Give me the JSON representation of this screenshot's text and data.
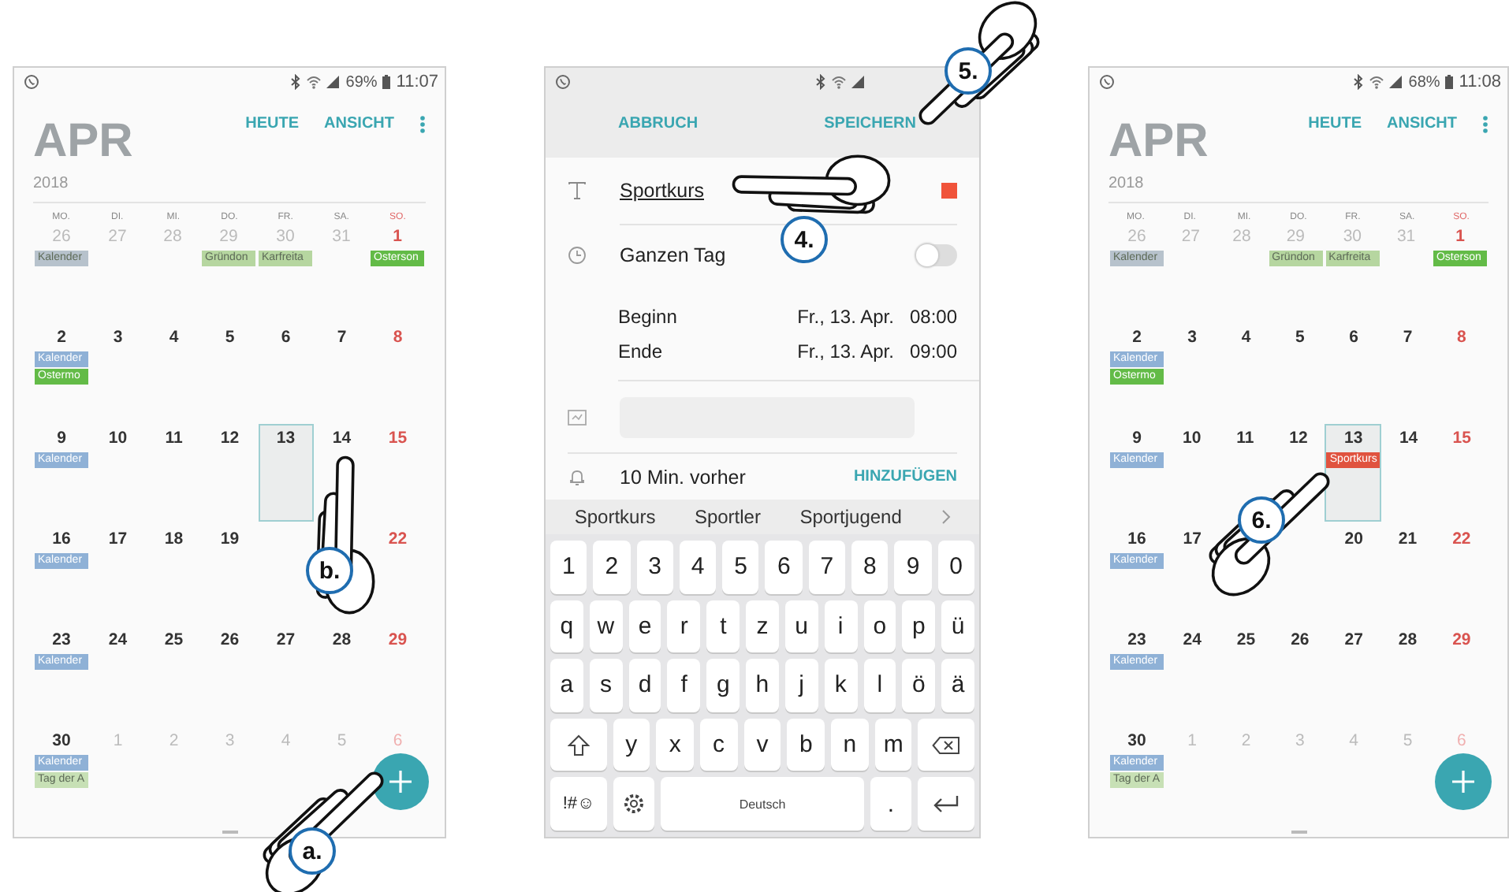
{
  "screens": [
    {
      "kind": "month",
      "status": {
        "battery": "69%",
        "time": "11:07"
      },
      "month": "APR",
      "year": "2018",
      "actions": [
        "HEUTE",
        "ANSICHT"
      ],
      "weekdays": [
        {
          "label": "MO.",
          "sunday": false
        },
        {
          "label": "DI.",
          "sunday": false
        },
        {
          "label": "MI.",
          "sunday": false
        },
        {
          "label": "DO.",
          "sunday": false
        },
        {
          "label": "FR.",
          "sunday": false
        },
        {
          "label": "SA.",
          "sunday": false
        },
        {
          "label": "SO.",
          "sunday": true
        }
      ],
      "weeks": [
        [
          {
            "day": "26",
            "muted": true,
            "selected": false,
            "events": [
              {
                "label": "Kalender",
                "color": "#b7c2cc"
              }
            ]
          },
          {
            "day": "27",
            "muted": true,
            "selected": false
          },
          {
            "day": "28",
            "muted": true,
            "selected": false
          },
          {
            "day": "29",
            "muted": true,
            "selected": false,
            "events": [
              {
                "label": "Gründon",
                "color": "#b6d6a0"
              }
            ]
          },
          {
            "day": "30",
            "muted": true,
            "selected": false,
            "events": [
              {
                "label": "Karfreita",
                "color": "#b6d6a0"
              }
            ]
          },
          {
            "day": "31",
            "muted": true,
            "selected": false
          },
          {
            "day": "1",
            "muted": false,
            "selected": false,
            "events": [
              {
                "label": "Osterson",
                "color": "#63bb47"
              }
            ]
          }
        ],
        [
          {
            "day": "2",
            "muted": false,
            "selected": false,
            "events": [
              {
                "label": "Kalender",
                "color": "#8fb1d6"
              },
              {
                "label": "Ostermo",
                "color": "#63bb47"
              }
            ]
          },
          {
            "day": "3",
            "muted": false,
            "selected": false
          },
          {
            "day": "4",
            "muted": false,
            "selected": false
          },
          {
            "day": "5",
            "muted": false,
            "selected": false
          },
          {
            "day": "6",
            "muted": false,
            "selected": false
          },
          {
            "day": "7",
            "muted": false,
            "selected": false
          },
          {
            "day": "8",
            "muted": false,
            "selected": false
          }
        ],
        [
          {
            "day": "9",
            "muted": false,
            "selected": false,
            "events": [
              {
                "label": "Kalender",
                "color": "#8fb1d6"
              }
            ]
          },
          {
            "day": "10",
            "muted": false,
            "selected": false
          },
          {
            "day": "11",
            "muted": false,
            "selected": false
          },
          {
            "day": "12",
            "muted": false,
            "selected": false
          },
          {
            "day": "13",
            "muted": false,
            "selected": true
          },
          {
            "day": "14",
            "muted": false,
            "selected": false
          },
          {
            "day": "15",
            "muted": false,
            "selected": false
          }
        ],
        [
          {
            "day": "16",
            "muted": false,
            "selected": false,
            "events": [
              {
                "label": "Kalender",
                "color": "#8fb1d6"
              }
            ]
          },
          {
            "day": "17",
            "muted": false,
            "selected": false
          },
          {
            "day": "18",
            "muted": false,
            "selected": false
          },
          {
            "day": "19",
            "muted": false,
            "selected": false
          },
          {
            "covered": true
          },
          {
            "covered": true
          },
          {
            "day": "22",
            "muted": false,
            "selected": false
          }
        ],
        [
          {
            "day": "23",
            "muted": false,
            "selected": false,
            "events": [
              {
                "label": "Kalender",
                "color": "#8fb1d6"
              }
            ]
          },
          {
            "day": "24",
            "muted": false,
            "selected": false
          },
          {
            "day": "25",
            "muted": false,
            "selected": false
          },
          {
            "day": "26",
            "muted": false,
            "selected": false
          },
          {
            "day": "27",
            "muted": false,
            "selected": false
          },
          {
            "day": "28",
            "muted": false,
            "selected": false
          },
          {
            "day": "29",
            "muted": false,
            "selected": false
          }
        ],
        [
          {
            "day": "30",
            "muted": false,
            "selected": false,
            "events": [
              {
                "label": "Kalender",
                "color": "#8fb1d6"
              },
              {
                "label": "Tag der A",
                "color": "#c7e0b5"
              }
            ]
          },
          {
            "day": "1",
            "muted": true,
            "selected": false
          },
          {
            "day": "2",
            "muted": true,
            "selected": false
          },
          {
            "day": "3",
            "muted": true,
            "selected": false
          },
          {
            "day": "4",
            "muted": true,
            "selected": false
          },
          {
            "day": "5",
            "muted": true,
            "selected": false
          },
          {
            "day": "6",
            "muted": true,
            "selected": false
          }
        ]
      ]
    },
    {
      "kind": "editor",
      "actions": [
        "ABBRUCH",
        "SPEICHERN"
      ],
      "title": {
        "value": "Sportkurs",
        "color": "#f0533a"
      },
      "all_day": {
        "label": "Ganzen Tag",
        "on": false
      },
      "times": [
        {
          "label": "Beginn",
          "date": "Fr., 13. Apr.",
          "time": "08:00"
        },
        {
          "label": "Ende",
          "date": "Fr., 13. Apr.",
          "time": "09:00"
        }
      ],
      "reminder": {
        "label": "10 Min. vorher",
        "action": "HINZUFÜGEN"
      },
      "suggestions": [
        "Sportkurs",
        "Sportler",
        "Sportjugend"
      ],
      "keyboard": [
        [
          {
            "kind": "char",
            "label": "1"
          },
          {
            "kind": "char",
            "label": "2"
          },
          {
            "kind": "char",
            "label": "3"
          },
          {
            "kind": "char",
            "label": "4"
          },
          {
            "kind": "char",
            "label": "5"
          },
          {
            "kind": "char",
            "label": "6"
          },
          {
            "kind": "char",
            "label": "7"
          },
          {
            "kind": "char",
            "label": "8"
          },
          {
            "kind": "char",
            "label": "9"
          },
          {
            "kind": "char",
            "label": "0"
          }
        ],
        [
          {
            "kind": "char",
            "label": "q"
          },
          {
            "kind": "char",
            "label": "w"
          },
          {
            "kind": "char",
            "label": "e"
          },
          {
            "kind": "char",
            "label": "r"
          },
          {
            "kind": "char",
            "label": "t"
          },
          {
            "kind": "char",
            "label": "z"
          },
          {
            "kind": "char",
            "label": "u"
          },
          {
            "kind": "char",
            "label": "i"
          },
          {
            "kind": "char",
            "label": "o"
          },
          {
            "kind": "char",
            "label": "p"
          },
          {
            "kind": "char",
            "label": "ü"
          }
        ],
        [
          {
            "kind": "char",
            "label": "a"
          },
          {
            "kind": "char",
            "label": "s"
          },
          {
            "kind": "char",
            "label": "d"
          },
          {
            "kind": "char",
            "label": "f"
          },
          {
            "kind": "char",
            "label": "g"
          },
          {
            "kind": "char",
            "label": "h"
          },
          {
            "kind": "char",
            "label": "j"
          },
          {
            "kind": "char",
            "label": "k"
          },
          {
            "kind": "char",
            "label": "l"
          },
          {
            "kind": "char",
            "label": "ö"
          },
          {
            "kind": "char",
            "label": "ä"
          }
        ],
        [
          {
            "kind": "shift"
          },
          {
            "kind": "char",
            "label": "y"
          },
          {
            "kind": "char",
            "label": "x"
          },
          {
            "kind": "char",
            "label": "c"
          },
          {
            "kind": "char",
            "label": "v"
          },
          {
            "kind": "char",
            "label": "b"
          },
          {
            "kind": "char",
            "label": "n"
          },
          {
            "kind": "char",
            "label": "m"
          },
          {
            "kind": "backspace"
          }
        ],
        [
          {
            "kind": "symbols",
            "label": "!#☺"
          },
          {
            "kind": "settings"
          },
          {
            "kind": "space",
            "label": "Deutsch"
          },
          {
            "kind": "char",
            "label": "."
          },
          {
            "kind": "enter"
          }
        ]
      ]
    },
    {
      "kind": "month",
      "status": {
        "battery": "68%",
        "time": "11:08"
      },
      "month": "APR",
      "year": "2018",
      "actions": [
        "HEUTE",
        "ANSICHT"
      ],
      "weekdays": [
        {
          "label": "MO.",
          "sunday": false
        },
        {
          "label": "DI.",
          "sunday": false
        },
        {
          "label": "MI.",
          "sunday": false
        },
        {
          "label": "DO.",
          "sunday": false
        },
        {
          "label": "FR.",
          "sunday": false
        },
        {
          "label": "SA.",
          "sunday": false
        },
        {
          "label": "SO.",
          "sunday": true
        }
      ],
      "weeks": [
        [
          {
            "day": "26",
            "muted": true,
            "selected": false,
            "events": [
              {
                "label": "Kalender",
                "color": "#b7c2cc"
              }
            ]
          },
          {
            "day": "27",
            "muted": true,
            "selected": false
          },
          {
            "day": "28",
            "muted": true,
            "selected": false
          },
          {
            "day": "29",
            "muted": true,
            "selected": false,
            "events": [
              {
                "label": "Gründon",
                "color": "#b6d6a0"
              }
            ]
          },
          {
            "day": "30",
            "muted": true,
            "selected": false,
            "events": [
              {
                "label": "Karfreita",
                "color": "#b6d6a0"
              }
            ]
          },
          {
            "day": "31",
            "muted": true,
            "selected": false
          },
          {
            "day": "1",
            "muted": false,
            "selected": false,
            "events": [
              {
                "label": "Osterson",
                "color": "#63bb47"
              }
            ]
          }
        ],
        [
          {
            "day": "2",
            "muted": false,
            "selected": false,
            "events": [
              {
                "label": "Kalender",
                "color": "#8fb1d6"
              },
              {
                "label": "Ostermo",
                "color": "#63bb47"
              }
            ]
          },
          {
            "day": "3",
            "muted": false,
            "selected": false
          },
          {
            "day": "4",
            "muted": false,
            "selected": false
          },
          {
            "day": "5",
            "muted": false,
            "selected": false
          },
          {
            "day": "6",
            "muted": false,
            "selected": false
          },
          {
            "day": "7",
            "muted": false,
            "selected": false
          },
          {
            "day": "8",
            "muted": false,
            "selected": false
          }
        ],
        [
          {
            "day": "9",
            "muted": false,
            "selected": false,
            "events": [
              {
                "label": "Kalender",
                "color": "#8fb1d6"
              }
            ]
          },
          {
            "day": "10",
            "muted": false,
            "selected": false
          },
          {
            "day": "11",
            "muted": false,
            "selected": false
          },
          {
            "day": "12",
            "muted": false,
            "selected": false
          },
          {
            "day": "13",
            "muted": false,
            "selected": true,
            "events": [
              {
                "label": "Sportkurs",
                "color": "#e0533f"
              }
            ]
          },
          {
            "day": "14",
            "muted": false,
            "selected": false
          },
          {
            "day": "15",
            "muted": false,
            "selected": false
          }
        ],
        [
          {
            "day": "16",
            "muted": false,
            "selected": false,
            "events": [
              {
                "label": "Kalender",
                "color": "#8fb1d6"
              }
            ]
          },
          {
            "day": "17",
            "muted": false,
            "selected": false
          },
          {
            "covered": true
          },
          {
            "covered": true
          },
          {
            "day": "20",
            "muted": false,
            "selected": false
          },
          {
            "day": "21",
            "muted": false,
            "selected": false
          },
          {
            "day": "22",
            "muted": false,
            "selected": false
          }
        ],
        [
          {
            "day": "23",
            "muted": false,
            "selected": false,
            "events": [
              {
                "label": "Kalender",
                "color": "#8fb1d6"
              }
            ]
          },
          {
            "day": "24",
            "muted": false,
            "selected": false
          },
          {
            "day": "25",
            "muted": false,
            "selected": false
          },
          {
            "day": "26",
            "muted": false,
            "selected": false
          },
          {
            "day": "27",
            "muted": false,
            "selected": false
          },
          {
            "day": "28",
            "muted": false,
            "selected": false
          },
          {
            "day": "29",
            "muted": false,
            "selected": false
          }
        ],
        [
          {
            "day": "30",
            "muted": false,
            "selected": false,
            "events": [
              {
                "label": "Kalender",
                "color": "#8fb1d6"
              },
              {
                "label": "Tag der A",
                "color": "#c7e0b5"
              }
            ]
          },
          {
            "day": "1",
            "muted": true,
            "selected": false
          },
          {
            "day": "2",
            "muted": true,
            "selected": false
          },
          {
            "day": "3",
            "muted": true,
            "selected": false
          },
          {
            "day": "4",
            "muted": true,
            "selected": false
          },
          {
            "day": "5",
            "muted": true,
            "selected": false
          },
          {
            "day": "6",
            "muted": true,
            "selected": false
          }
        ]
      ]
    }
  ],
  "callouts": [
    {
      "label": "a."
    },
    {
      "label": "b."
    },
    {
      "label": "4."
    },
    {
      "label": "5."
    },
    {
      "label": "6."
    }
  ]
}
